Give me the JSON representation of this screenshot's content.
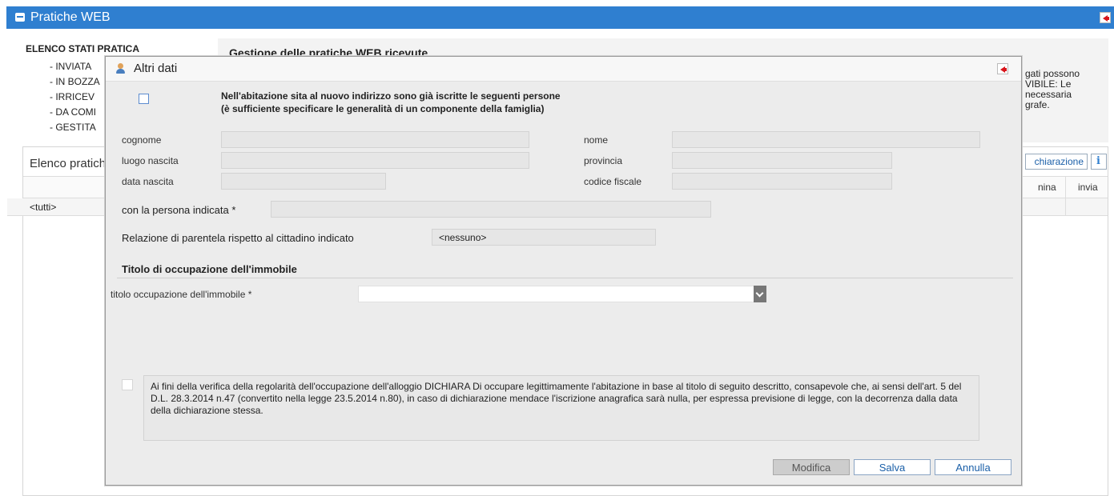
{
  "app": {
    "title": "Pratiche WEB"
  },
  "background": {
    "status_list": {
      "header": "ELENCO STATI PRATICA",
      "items": [
        "INVIATA",
        "IN BOZZA",
        "IRRICEV",
        "DA COMI",
        "GESTITA"
      ]
    },
    "main_header": "Gestione delle pratiche WEB ricevute",
    "side_text_lines": [
      "gati possono",
      "VIBILE: Le",
      " necessaria",
      "grafe."
    ],
    "list_title": "Elenco pratich",
    "dichiarazione_label": "chiarazione",
    "columns": {
      "esamina": "nina",
      "invia": "invia"
    },
    "filter_value": "<tutti>"
  },
  "modal": {
    "title": "Altri dati",
    "persons_section": {
      "line1": "Nell'abitazione sita al nuovo indirizzo sono già iscritte le seguenti persone",
      "line2": "(è sufficiente specificare le generalità di un componente della famiglia)"
    },
    "fields": {
      "cognome": {
        "label": "cognome",
        "value": ""
      },
      "nome": {
        "label": "nome",
        "value": ""
      },
      "luogo_nascita": {
        "label": "luogo nascita",
        "value": ""
      },
      "provincia": {
        "label": "provincia",
        "value": ""
      },
      "data_nascita": {
        "label": "data nascita",
        "value": ""
      },
      "codice_fiscale": {
        "label": "codice fiscale",
        "value": ""
      },
      "persona_indicata": {
        "label": "con la persona indicata *",
        "value": ""
      },
      "relazione": {
        "label": "Relazione di parentela rispetto al cittadino indicato",
        "value": "<nessuno>"
      }
    },
    "occupation_section": {
      "title": "Titolo di occupazione dell'immobile",
      "select_label": "titolo occupazione dell'immobile *",
      "select_value": ""
    },
    "declaration_text": "Ai fini della verifica della regolarità dell'occupazione dell'alloggio DICHIARA Di occupare legittimamente l'abitazione in base al titolo di seguito descritto, consapevole che, ai sensi dell'art. 5 del D.L. 28.3.2014 n.47 (convertito nella legge 23.5.2014 n.80), in caso di dichiarazione mendace l'iscrizione anagrafica sarà nulla, per espressa previsione di legge, con la decorrenza dalla data della dichiarazione stessa.",
    "buttons": {
      "modifica": "Modifica",
      "salva": "Salva",
      "annulla": "Annulla"
    }
  },
  "colors": {
    "appbar": "#2f7fd0",
    "close_icon": "#d8141b",
    "link": "#1a5fa8"
  }
}
